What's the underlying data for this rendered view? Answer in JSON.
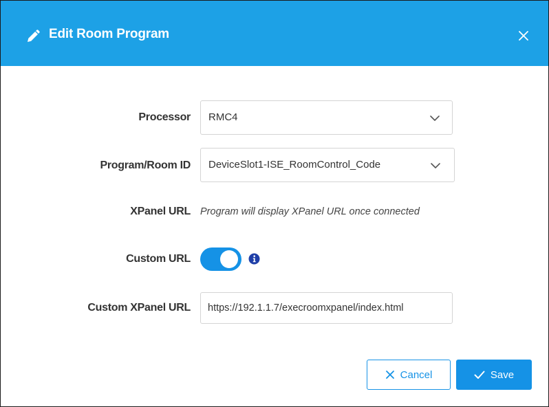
{
  "dialog": {
    "title": "Edit Room Program",
    "title_icon": "pencil-icon",
    "close_icon": "close-icon",
    "header_color": "#1da1e6"
  },
  "form": {
    "processor": {
      "label": "Processor",
      "value": "RMC4",
      "icon": "chevron-down-icon"
    },
    "program_room_id": {
      "label": "Program/Room ID",
      "value": "DeviceSlot1-ISE_RoomControl_Code",
      "icon": "chevron-down-icon"
    },
    "xpanel_url": {
      "label": "XPanel URL",
      "hint": "Program will display XPanel URL once connected"
    },
    "custom_url": {
      "label": "Custom URL",
      "enabled": true,
      "info_icon": "info-icon"
    },
    "custom_xpanel_url": {
      "label": "Custom XPanel URL",
      "value": "https://192.1.1.7/execroomxpanel/index.html"
    }
  },
  "actions": {
    "cancel_label": "Cancel",
    "cancel_icon": "close-icon",
    "save_label": "Save",
    "save_icon": "checkmark-icon"
  },
  "colors": {
    "accent": "#1592e6",
    "header": "#1da1e6",
    "label_text": "#333333",
    "border": "#d4d4d4"
  }
}
